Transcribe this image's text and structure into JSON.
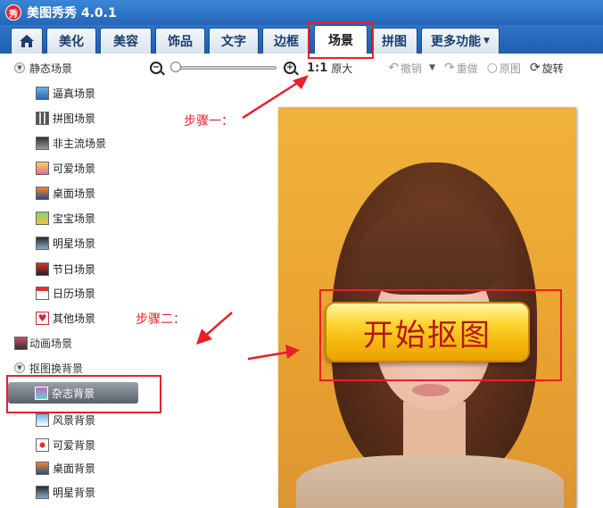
{
  "window": {
    "title": "美图秀秀 4.0.1",
    "logo_text": "秀"
  },
  "tabs": [
    {
      "label": "",
      "icon": "home-icon"
    },
    {
      "label": "美化"
    },
    {
      "label": "美容"
    },
    {
      "label": "饰品"
    },
    {
      "label": "文字"
    },
    {
      "label": "边框"
    },
    {
      "label": "场景",
      "active": true
    },
    {
      "label": "拼图"
    },
    {
      "label": "更多功能"
    }
  ],
  "sidebar": {
    "groups": [
      {
        "label": "静态场景",
        "expanded": true,
        "items": [
          "逼真场景",
          "拼图场景",
          "非主流场景",
          "可爱场景",
          "桌面场景",
          "宝宝场景",
          "明星场景",
          "节日场景",
          "日历场景",
          "其他场景"
        ]
      },
      {
        "label": "动画场景",
        "expanded": false
      },
      {
        "label": "抠图换背景",
        "expanded": true,
        "items": [
          "杂志背景",
          "风景背景",
          "可爱背景",
          "桌面背景",
          "明星背景"
        ],
        "selected": "杂志背景"
      }
    ]
  },
  "toolbar": {
    "zoom_reset": "1:1",
    "original_size": "原大",
    "undo": "撤销",
    "redo": "重做",
    "original": "原图",
    "rotate": "旋转",
    "zoom_level": 0
  },
  "canvas": {
    "start_button": "开始抠图"
  },
  "annotations": {
    "step1": "步骤一：",
    "step2": "步骤二："
  },
  "colors": {
    "accent": "#2566b8",
    "annotation": "#e8202a",
    "button_text": "#b5161a"
  }
}
